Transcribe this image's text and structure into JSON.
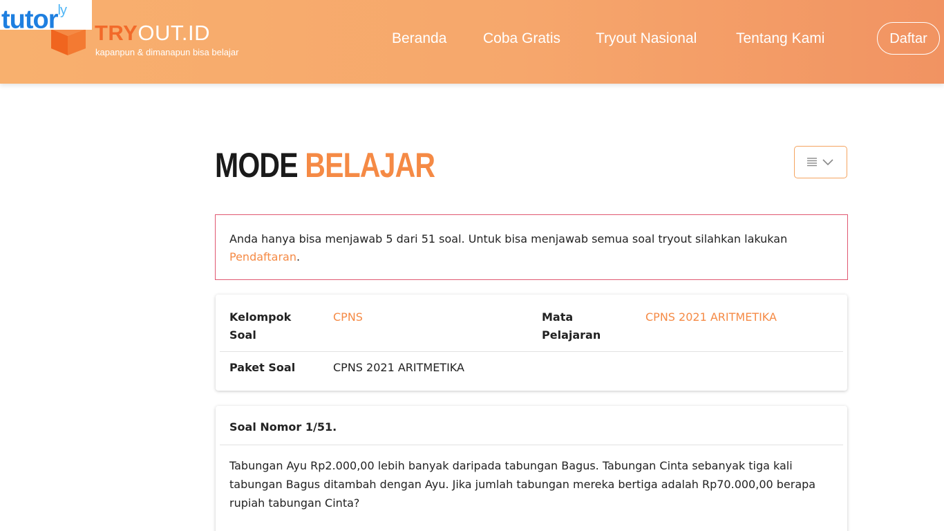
{
  "watermark": {
    "text": "tutor",
    "sup": "ly"
  },
  "header": {
    "brand_accent": "TRY",
    "brand_rest": "OUT.ID",
    "tagline": "kapanpun & dimanapun bisa belajar",
    "nav": [
      "Beranda",
      "Coba Gratis",
      "Tryout Nasional",
      "Tentang Kami"
    ],
    "register_label": "Daftar"
  },
  "page": {
    "title_part1": "MODE",
    "title_part2": "BELAJAR",
    "menu_icon": "list-icon",
    "chevron_icon": "chevron-down-icon"
  },
  "alert": {
    "text": "Anda hanya bisa menjawab 5 dari 51 soal. Untuk bisa menjawab semua soal tryout silahkan lakukan",
    "link": "Pendaftaran",
    "suffix": "."
  },
  "info": {
    "kelompok_label_1": "Kelompok",
    "kelompok_label_2": "Soal",
    "kelompok_value": "CPNS",
    "mapel_label_1": "Mata",
    "mapel_label_2": "Pelajaran",
    "mapel_value": "CPNS 2021 ARITMETIKA",
    "paket_label": "Paket Soal",
    "paket_value": "CPNS 2021 ARITMETIKA"
  },
  "question": {
    "header": "Soal Nomor 1/51.",
    "text": "Tabungan Ayu Rp2.000,00 lebih banyak daripada tabungan Bagus. Tabungan Cinta sebanyak tiga kali tabungan Bagus ditambah dengan Ayu. Jika jumlah tabungan mereka bertiga adalah Rp70.000,00 berapa rupiah tabungan Cinta?"
  },
  "colors": {
    "accent": "#f58a45",
    "alert_border": "#e05770",
    "header_start": "#f8b06e",
    "header_end": "#f19362"
  }
}
